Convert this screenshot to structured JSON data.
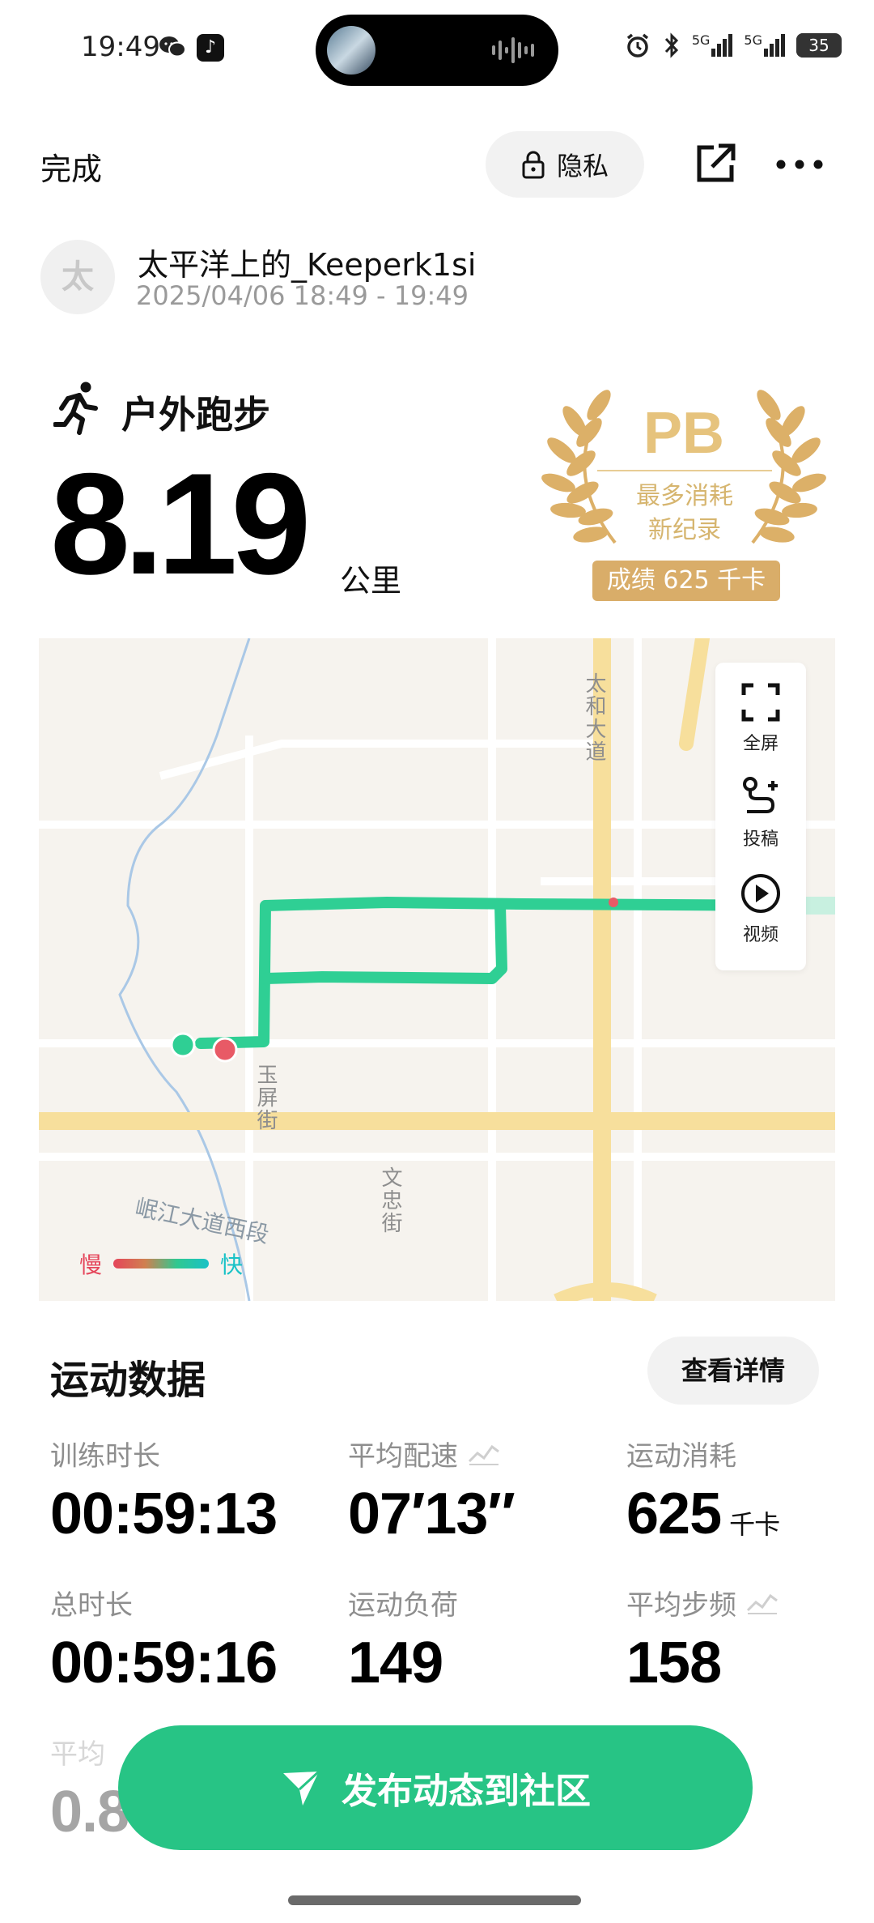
{
  "status_bar": {
    "time": "19:49",
    "network_1": "5G",
    "network_2": "5G",
    "battery": "35"
  },
  "header": {
    "done_label": "完成",
    "privacy_label": "隐私"
  },
  "user": {
    "avatar_char": "太",
    "name": "太平洋上的_Keeperk1si",
    "time_range": "2025/04/06 18:49 - 19:49"
  },
  "activity": {
    "type": "户外跑步",
    "distance": "8.19",
    "distance_unit": "公里"
  },
  "pb_badge": {
    "title": "PB",
    "subtitle_line1": "最多消耗",
    "subtitle_line2": "新纪录",
    "result": "成绩 625 千卡",
    "color": "#d9ad69"
  },
  "map": {
    "labels": {
      "taihe_road": "太和大道",
      "yuping_street": "玉屏街",
      "wenzhong_street": "文忠街",
      "minjiang_road": "岷江大道西段"
    },
    "legend": {
      "slow": "慢",
      "fast": "快"
    },
    "tools": {
      "fullscreen": "全屏",
      "submit": "投稿",
      "video": "视频"
    },
    "track_color": "#2fcf94"
  },
  "stats": {
    "title": "运动数据",
    "detail_button": "查看详情",
    "items": [
      {
        "label": "训练时长",
        "value": "00:59:13",
        "unit": ""
      },
      {
        "label": "平均配速",
        "value": "07′13″",
        "unit": ""
      },
      {
        "label": "运动消耗",
        "value": "625",
        "unit": "千卡"
      },
      {
        "label": "总时长",
        "value": "00:59:16",
        "unit": ""
      },
      {
        "label": "运动负荷",
        "value": "149",
        "unit": ""
      },
      {
        "label": "平均步频",
        "value": "158",
        "unit": ""
      },
      {
        "label": "平均",
        "value": "0.8",
        "unit": ""
      }
    ]
  },
  "publish_button": "发布动态到社区",
  "colors": {
    "accent": "#27c485",
    "gold": "#d9ad69"
  }
}
